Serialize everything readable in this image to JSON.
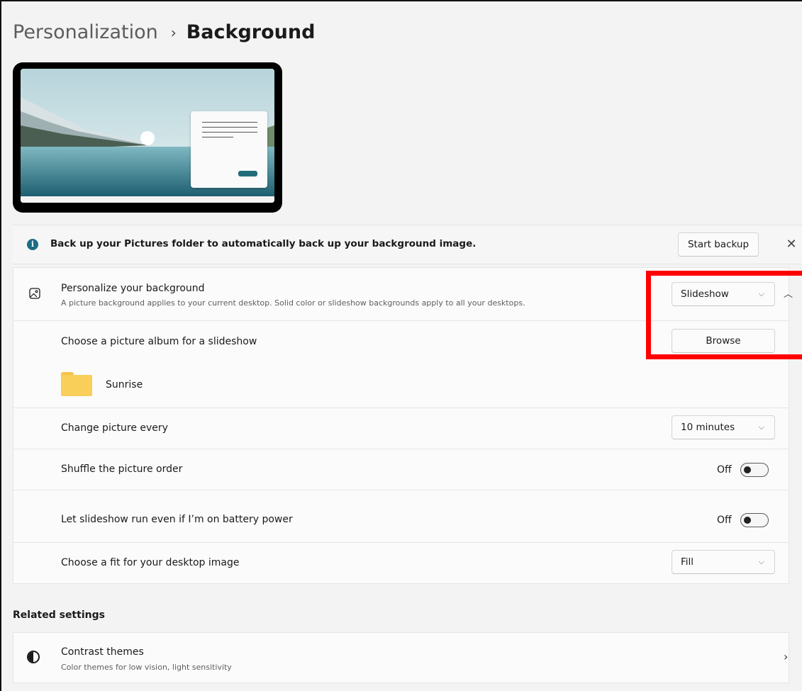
{
  "breadcrumb": {
    "parent": "Personalization",
    "separator": "›",
    "current": "Background"
  },
  "banner": {
    "icon": "info-icon",
    "text": "Back up your Pictures folder to automatically back up your background image.",
    "button_label": "Start backup",
    "close_glyph": "✕"
  },
  "background_setting": {
    "title": "Personalize your background",
    "subtitle": "A picture background applies to your current desktop. Solid color or slideshow backgrounds apply to all your desktops.",
    "selected": "Slideshow",
    "expanded": true
  },
  "album": {
    "label": "Choose a picture album for a slideshow",
    "button_label": "Browse",
    "folder_name": "Sunrise"
  },
  "interval": {
    "label": "Change picture every",
    "selected": "10 minutes"
  },
  "shuffle": {
    "label": "Shuffle the picture order",
    "state_label": "Off",
    "on": false
  },
  "battery": {
    "label": "Let slideshow run even if I’m on battery power",
    "state_label": "Off",
    "on": false
  },
  "fit": {
    "label": "Choose a fit for your desktop image",
    "selected": "Fill"
  },
  "related": {
    "heading": "Related settings",
    "items": [
      {
        "title": "Contrast themes",
        "subtitle": "Color themes for low vision, light sensitivity"
      }
    ]
  },
  "glyphs": {
    "chevron_down": "⌵",
    "chevron_up": "︿",
    "chevron_right": "›"
  },
  "colors": {
    "highlight": "#ff0000",
    "accent": "#1c6c84",
    "folder": "#f9cf5a"
  }
}
